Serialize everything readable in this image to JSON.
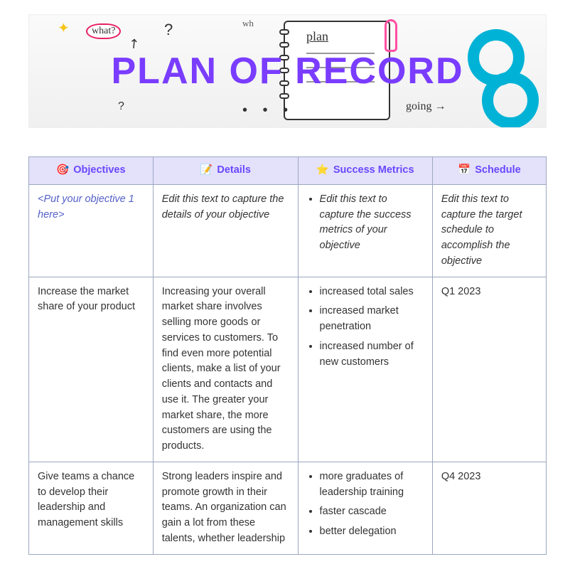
{
  "banner": {
    "title": "PLAN OF RECORD",
    "doodle_what": "what?",
    "notebook_word": "plan",
    "going_word": "going"
  },
  "columns": [
    {
      "icon": "🎯",
      "label": "Objectives"
    },
    {
      "icon": "📝",
      "label": "Details"
    },
    {
      "icon": "⭐",
      "label": "Success Metrics"
    },
    {
      "icon": "📅",
      "label": "Schedule"
    }
  ],
  "rows": [
    {
      "placeholder": true,
      "objective": "<Put your objective 1 here>",
      "details": "Edit this text to capture the details of your objective",
      "metrics": [
        "Edit this text to capture the success metrics of your objective"
      ],
      "schedule": "Edit this text to capture the target schedule to accomplish the objective"
    },
    {
      "placeholder": false,
      "objective": "Increase the market share of your product",
      "details": "Increasing your overall market share involves selling more goods or services to customers. To find even more potential clients, make a list of your clients and contacts and use it. The greater your market share, the more customers are using the products.",
      "metrics": [
        "increased total sales",
        "increased market penetration",
        "increased number of new customers"
      ],
      "schedule": "Q1 2023"
    },
    {
      "placeholder": false,
      "objective": "Give teams a chance to develop their leadership and management skills",
      "details": "Strong leaders inspire and promote growth in their teams. An organization can gain a lot from these talents, whether leadership",
      "metrics": [
        "more graduates of leadership training",
        "faster cascade",
        "better delegation"
      ],
      "schedule": "Q4 2023"
    }
  ]
}
